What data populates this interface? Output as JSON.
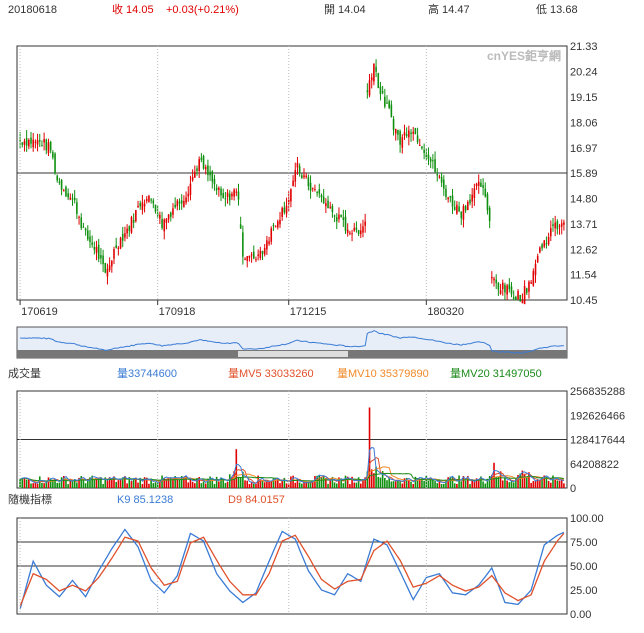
{
  "header": {
    "date": "20180618",
    "close_label": "收 14.05",
    "change": "+0.03(+0.21%)",
    "open_label": "開 14.04",
    "high_label": "高 14.47",
    "low_label": "低 13.68"
  },
  "watermark": "cnYES鉅亨網",
  "colors": {
    "up": "#e00000",
    "down": "#109010",
    "vol": "#3a7bd5",
    "mv5": "#e0502a",
    "mv10": "#f08a2a",
    "mv20": "#1a8a1a",
    "k": "#3a7bd5",
    "d": "#e0502a",
    "nav": "#3a7bd5"
  },
  "price_panel": {
    "y_ticks": [
      "21.33",
      "20.24",
      "19.15",
      "18.06",
      "16.97",
      "15.89",
      "14.80",
      "13.71",
      "12.62",
      "11.54",
      "10.45"
    ],
    "y_tick_values": [
      21.33,
      20.24,
      19.15,
      18.06,
      16.97,
      15.89,
      14.8,
      13.71,
      12.62,
      11.54,
      10.45
    ],
    "ref_line": 15.89,
    "x_ticks": [
      {
        "label": "170619",
        "idx": 0
      },
      {
        "label": "170918",
        "idx": 63
      },
      {
        "label": "171215",
        "idx": 123
      },
      {
        "label": "180320",
        "idx": 186
      }
    ]
  },
  "volume_panel": {
    "title": "成交量",
    "vol_label": "量33744600",
    "mv5_label": "量MV5 33033260",
    "mv10_label": "量MV10 35379890",
    "mv20_label": "量MV20 31497050",
    "y_ticks": [
      "256835288",
      "192626466",
      "128417644",
      "64208822",
      "0"
    ],
    "ref_line": 128417644,
    "max": 256835288
  },
  "kd_panel": {
    "title": "隨機指標",
    "k_label": "K9 85.1238",
    "d_label": "D9 84.0157",
    "y_ticks": [
      "100.00",
      "75.00",
      "50.00",
      "25.00",
      "0.00"
    ],
    "ref_lines": [
      75,
      50
    ]
  },
  "chart_data": {
    "type": "candlestick",
    "count": 250,
    "x_ticks": [
      "170619",
      "170918",
      "171215",
      "180320"
    ],
    "price_close_keypoints": [
      [
        0,
        17.3
      ],
      [
        10,
        17.2
      ],
      [
        14,
        16.9
      ],
      [
        17,
        15.6
      ],
      [
        25,
        14.6
      ],
      [
        30,
        13.2
      ],
      [
        35,
        12.6
      ],
      [
        39,
        11.5
      ],
      [
        44,
        12.8
      ],
      [
        50,
        13.6
      ],
      [
        56,
        14.8
      ],
      [
        61,
        14.7
      ],
      [
        65,
        13.7
      ],
      [
        70,
        14.4
      ],
      [
        76,
        15.0
      ],
      [
        82,
        16.4
      ],
      [
        88,
        15.5
      ],
      [
        93,
        14.7
      ],
      [
        98,
        15.1
      ],
      [
        100,
        14.9
      ],
      [
        102,
        12.3
      ],
      [
        106,
        12.2
      ],
      [
        111,
        12.6
      ],
      [
        117,
        13.8
      ],
      [
        122,
        14.6
      ],
      [
        127,
        16.1
      ],
      [
        132,
        15.4
      ],
      [
        138,
        14.8
      ],
      [
        143,
        14.2
      ],
      [
        148,
        13.7
      ],
      [
        153,
        13.3
      ],
      [
        158,
        13.8
      ],
      [
        159,
        19.5
      ],
      [
        162,
        20.6
      ],
      [
        165,
        19.3
      ],
      [
        169,
        18.5
      ],
      [
        174,
        17.2
      ],
      [
        178,
        17.9
      ],
      [
        183,
        17.3
      ],
      [
        188,
        16.4
      ],
      [
        192,
        15.6
      ],
      [
        197,
        14.7
      ],
      [
        202,
        14.2
      ],
      [
        207,
        15.0
      ],
      [
        211,
        15.4
      ],
      [
        215,
        14.0
      ],
      [
        216,
        11.4
      ],
      [
        220,
        11.0
      ],
      [
        226,
        10.7
      ],
      [
        230,
        10.6
      ],
      [
        234,
        11.4
      ],
      [
        238,
        12.6
      ],
      [
        243,
        13.4
      ],
      [
        249,
        13.9
      ]
    ],
    "gaps_after": [
      100,
      158,
      215
    ],
    "volume_spikes": [
      [
        99,
        0.4
      ],
      [
        160,
        0.78
      ],
      [
        163,
        0.22
      ],
      [
        217,
        0.26
      ],
      [
        230,
        0.18
      ]
    ],
    "kd_keypoints_k": [
      [
        0,
        5
      ],
      [
        6,
        55
      ],
      [
        12,
        30
      ],
      [
        18,
        18
      ],
      [
        24,
        35
      ],
      [
        30,
        18
      ],
      [
        36,
        45
      ],
      [
        42,
        68
      ],
      [
        48,
        88
      ],
      [
        54,
        70
      ],
      [
        60,
        35
      ],
      [
        66,
        22
      ],
      [
        72,
        40
      ],
      [
        78,
        84
      ],
      [
        84,
        76
      ],
      [
        90,
        42
      ],
      [
        96,
        24
      ],
      [
        102,
        12
      ],
      [
        108,
        22
      ],
      [
        114,
        55
      ],
      [
        120,
        86
      ],
      [
        126,
        78
      ],
      [
        132,
        45
      ],
      [
        138,
        25
      ],
      [
        144,
        20
      ],
      [
        150,
        42
      ],
      [
        156,
        34
      ],
      [
        162,
        78
      ],
      [
        168,
        72
      ],
      [
        174,
        44
      ],
      [
        180,
        15
      ],
      [
        186,
        38
      ],
      [
        192,
        42
      ],
      [
        198,
        22
      ],
      [
        204,
        20
      ],
      [
        210,
        30
      ],
      [
        216,
        48
      ],
      [
        222,
        12
      ],
      [
        228,
        10
      ],
      [
        234,
        25
      ],
      [
        240,
        72
      ],
      [
        246,
        82
      ],
      [
        249,
        85
      ]
    ],
    "kd_keypoints_d": [
      [
        0,
        8
      ],
      [
        6,
        42
      ],
      [
        12,
        36
      ],
      [
        18,
        24
      ],
      [
        24,
        30
      ],
      [
        30,
        24
      ],
      [
        36,
        38
      ],
      [
        42,
        58
      ],
      [
        48,
        80
      ],
      [
        54,
        76
      ],
      [
        60,
        48
      ],
      [
        66,
        30
      ],
      [
        72,
        34
      ],
      [
        78,
        74
      ],
      [
        84,
        80
      ],
      [
        90,
        56
      ],
      [
        96,
        34
      ],
      [
        102,
        20
      ],
      [
        108,
        20
      ],
      [
        114,
        42
      ],
      [
        120,
        76
      ],
      [
        126,
        82
      ],
      [
        132,
        60
      ],
      [
        138,
        36
      ],
      [
        144,
        26
      ],
      [
        150,
        34
      ],
      [
        156,
        36
      ],
      [
        162,
        66
      ],
      [
        168,
        76
      ],
      [
        174,
        56
      ],
      [
        180,
        28
      ],
      [
        186,
        32
      ],
      [
        192,
        40
      ],
      [
        198,
        30
      ],
      [
        204,
        24
      ],
      [
        210,
        28
      ],
      [
        216,
        40
      ],
      [
        222,
        22
      ],
      [
        228,
        14
      ],
      [
        234,
        20
      ],
      [
        240,
        55
      ],
      [
        246,
        76
      ],
      [
        249,
        84
      ]
    ]
  }
}
